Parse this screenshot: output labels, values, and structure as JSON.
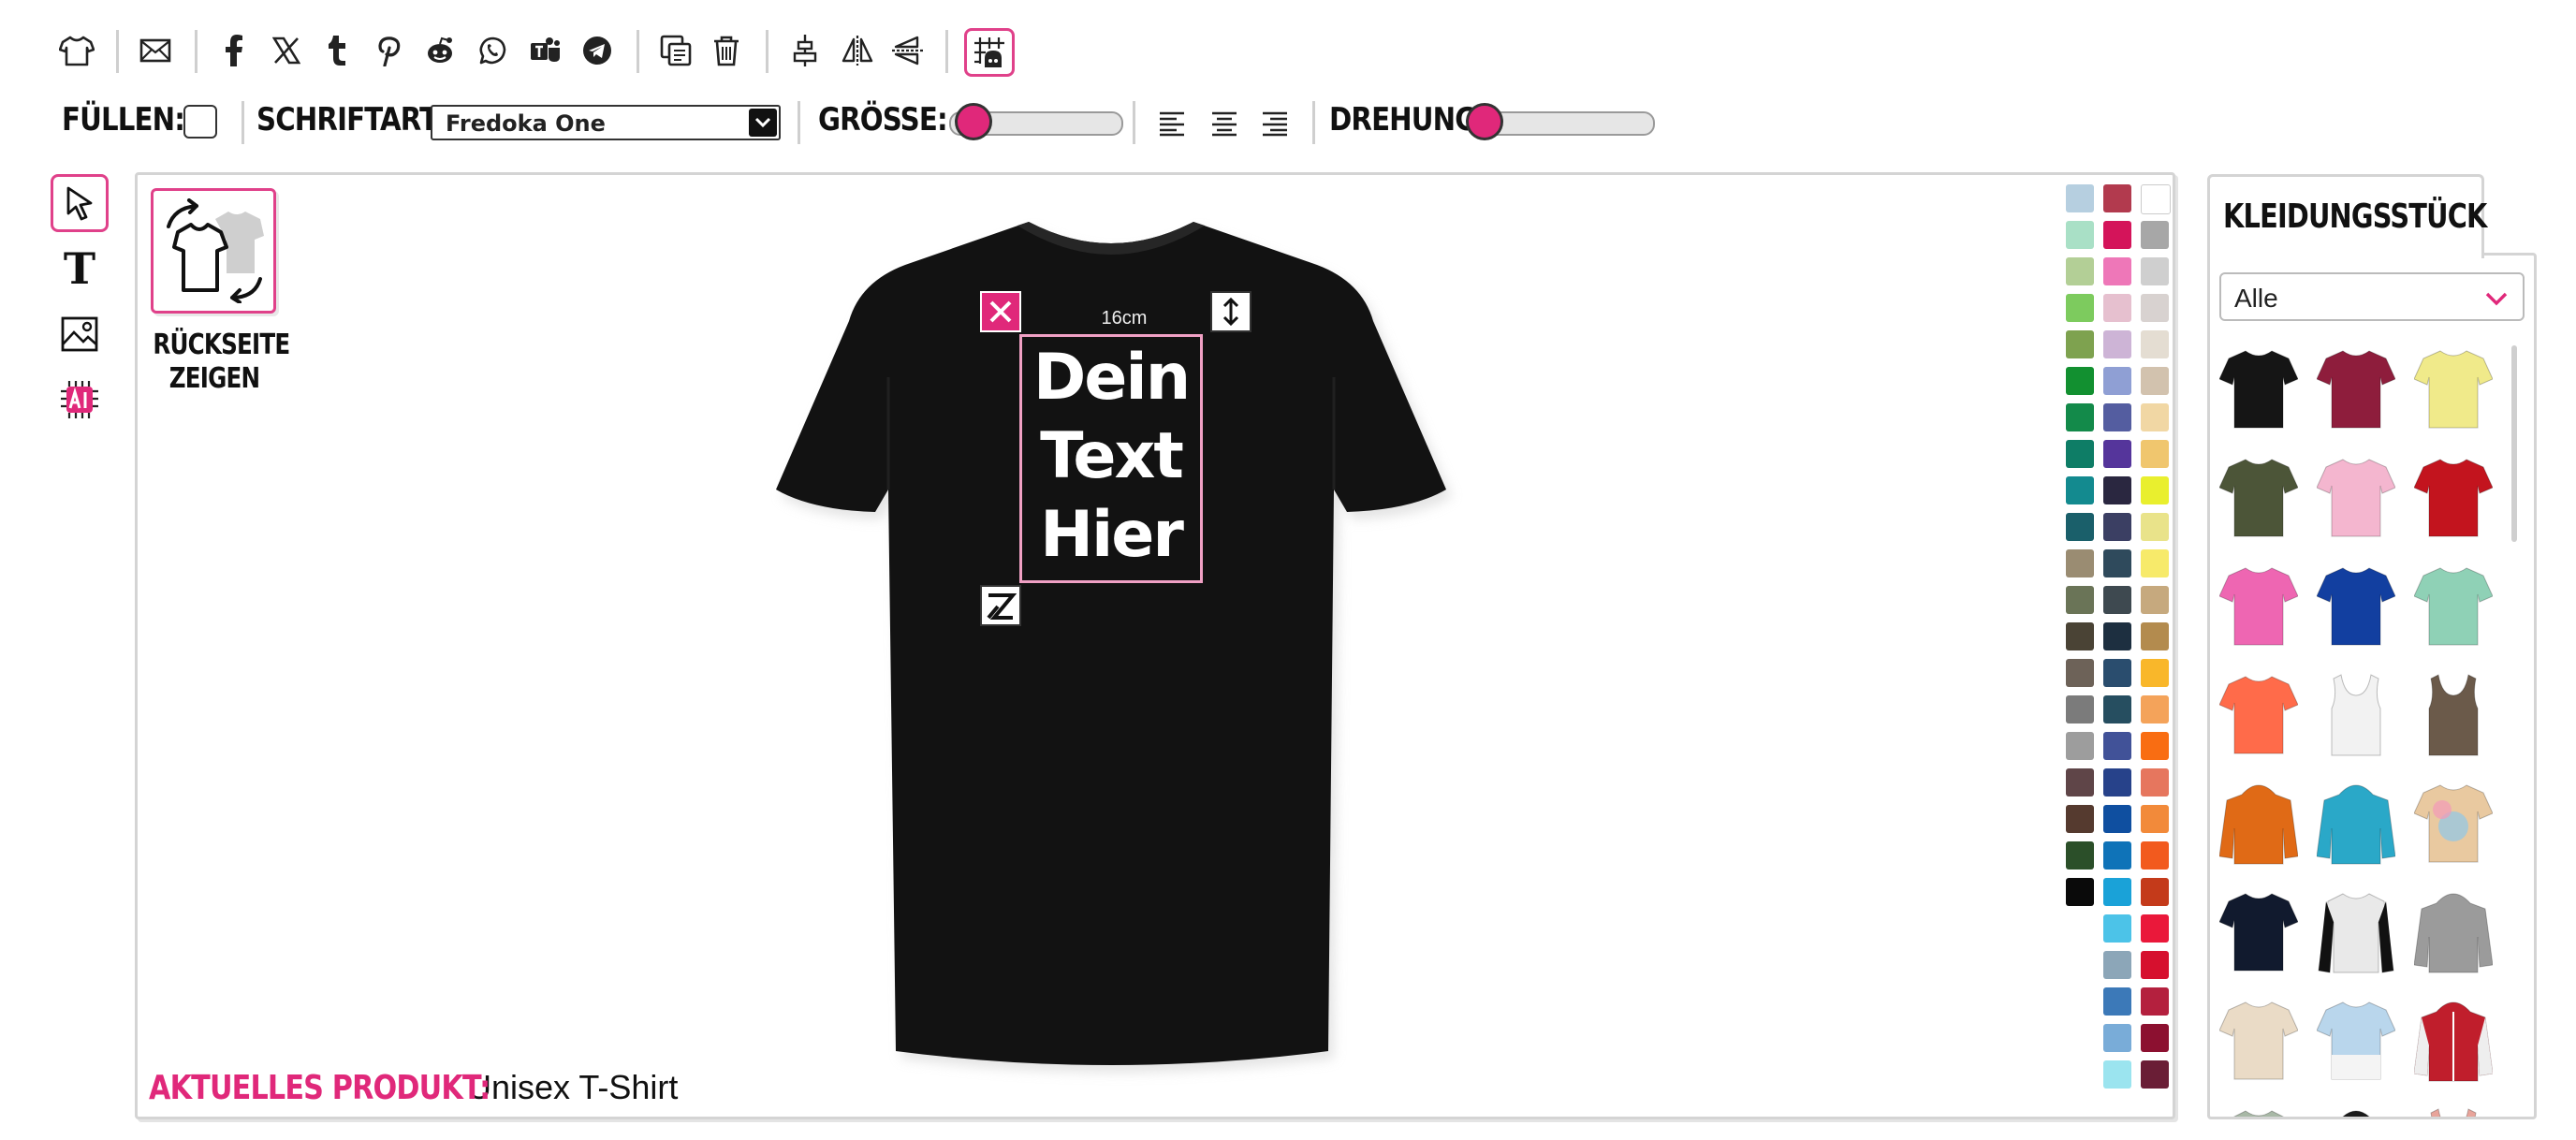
{
  "toolbar": {
    "icons": [
      "tshirt-icon",
      "mail-icon",
      "facebook-icon",
      "x-icon",
      "tumblr-icon",
      "pinterest-icon",
      "reddit-icon",
      "whatsapp-icon",
      "teams-icon",
      "telegram-icon",
      "duplicate-icon",
      "trash-icon",
      "center-icon",
      "flip-horizontal-icon",
      "flip-vertical-icon",
      "grid-icon"
    ]
  },
  "options": {
    "fill_label": "FÜLLEN:",
    "font_label": "SCHRIFTART:",
    "font_value": "Fredoka One",
    "size_label": "GRÖSSE:",
    "size_level": 0.0,
    "rotation_label": "DREHUNG:",
    "rotation_level": 0.0
  },
  "left_tools": [
    "select-tool",
    "text-tool",
    "image-tool",
    "ai-tool"
  ],
  "back_button": {
    "line1": "RÜCKSEITE",
    "line2": "ZEIGEN"
  },
  "design": {
    "size_label": "16cm",
    "text_lines": [
      "Dein",
      "Text",
      "Hier"
    ]
  },
  "current_product": {
    "label": "AKTUELLES PRODUKT:",
    "value": "Unisex T-Shirt"
  },
  "colors": {
    "accent": "#e0287a",
    "shirt": "#121212",
    "col1": [
      "#b6cfe0",
      "#a9e0c6",
      "#b3cf96",
      "#7dcb5e",
      "#7ea24f",
      "#129030",
      "#138a4a",
      "#0e7d66",
      "#138a8f",
      "#1a5f6a",
      "#9a8c72",
      "#6a7457",
      "#4a4335",
      "#6d6258",
      "#7b7b7b",
      "#9d9d9d",
      "#5f4548",
      "#553a2f",
      "#2b4f29",
      "#0a0a0a"
    ],
    "col2": [
      "#b23a4e",
      "#d4145a",
      "#ee77b8",
      "#e6c0cf",
      "#cdb4d6",
      "#8f9fd4",
      "#545da0",
      "#55359b",
      "#2a2740",
      "#3b3f63",
      "#2f4a5c",
      "#3e4950",
      "#1d2f40",
      "#2a4d6e",
      "#264e60",
      "#415298",
      "#27428a",
      "#0f4fa0",
      "#0f73b8",
      "#1aa2d8",
      "#4cc3e8",
      "#8ca6b8",
      "#3c79b8",
      "#79acd8",
      "#9be4ef"
    ],
    "col3": [
      "#ffffff",
      "#a7a7a7",
      "#cfcfcf",
      "#d8d2d0",
      "#e4ddd2",
      "#d2c2ae",
      "#f1d7a4",
      "#f0c66e",
      "#e9ef2e",
      "#e9e38a",
      "#f7ea6a",
      "#c6a97e",
      "#b38b4e",
      "#f9b72a",
      "#f4a35a",
      "#f96d12",
      "#e6765e",
      "#f28a3a",
      "#f25a1e",
      "#c43a1a",
      "#ea183a",
      "#d6102e",
      "#b4203e",
      "#8c1030",
      "#6a1e36"
    ]
  },
  "panel": {
    "tab": "KLEIDUNGSSTÜCK",
    "filter_value": "Alle",
    "garments": [
      {
        "name": "black-tshirt",
        "color": "#151515"
      },
      {
        "name": "maroon-tshirt",
        "color": "#8e1d3c"
      },
      {
        "name": "yellow-tshirt",
        "color": "#f0ea8a"
      },
      {
        "name": "olive-tshirt",
        "color": "#4c5538"
      },
      {
        "name": "pink-tshirt",
        "color": "#f4b6cf"
      },
      {
        "name": "red-tshirt",
        "color": "#c3141e"
      },
      {
        "name": "fuchsia-tshirt",
        "color": "#ee66b2"
      },
      {
        "name": "royal-blue-tshirt",
        "color": "#123fa0"
      },
      {
        "name": "mint-tshirt",
        "color": "#8fd1b6"
      },
      {
        "name": "coral-tshirt",
        "color": "#ff6b4a"
      },
      {
        "name": "white-tanktop",
        "color": "#f2f2f2"
      },
      {
        "name": "brown-tanktop",
        "color": "#6b5a4a"
      },
      {
        "name": "orange-hoodie",
        "color": "#e06a16"
      },
      {
        "name": "turquoise-hoodie",
        "color": "#2aa8c8"
      },
      {
        "name": "tiedye-tshirt",
        "color": "#e9c9a0"
      },
      {
        "name": "navy-tshirt",
        "color": "#111a2e"
      },
      {
        "name": "raglan-tshirt",
        "color": "#e9e9e9"
      },
      {
        "name": "grey-hoodie",
        "color": "#9b9b9b"
      },
      {
        "name": "cream-tshirt",
        "color": "#eadbc6"
      },
      {
        "name": "gradient-tshirt",
        "color": "#b9d6ec"
      },
      {
        "name": "college-jacket",
        "color": "#c01e2c"
      },
      {
        "name": "sage-longsleeve",
        "color": "#a8b8a6"
      },
      {
        "name": "black-orange-hoodie",
        "color": "#1b1b1b"
      },
      {
        "name": "rose-tanktop",
        "color": "#e8a49a"
      }
    ]
  }
}
